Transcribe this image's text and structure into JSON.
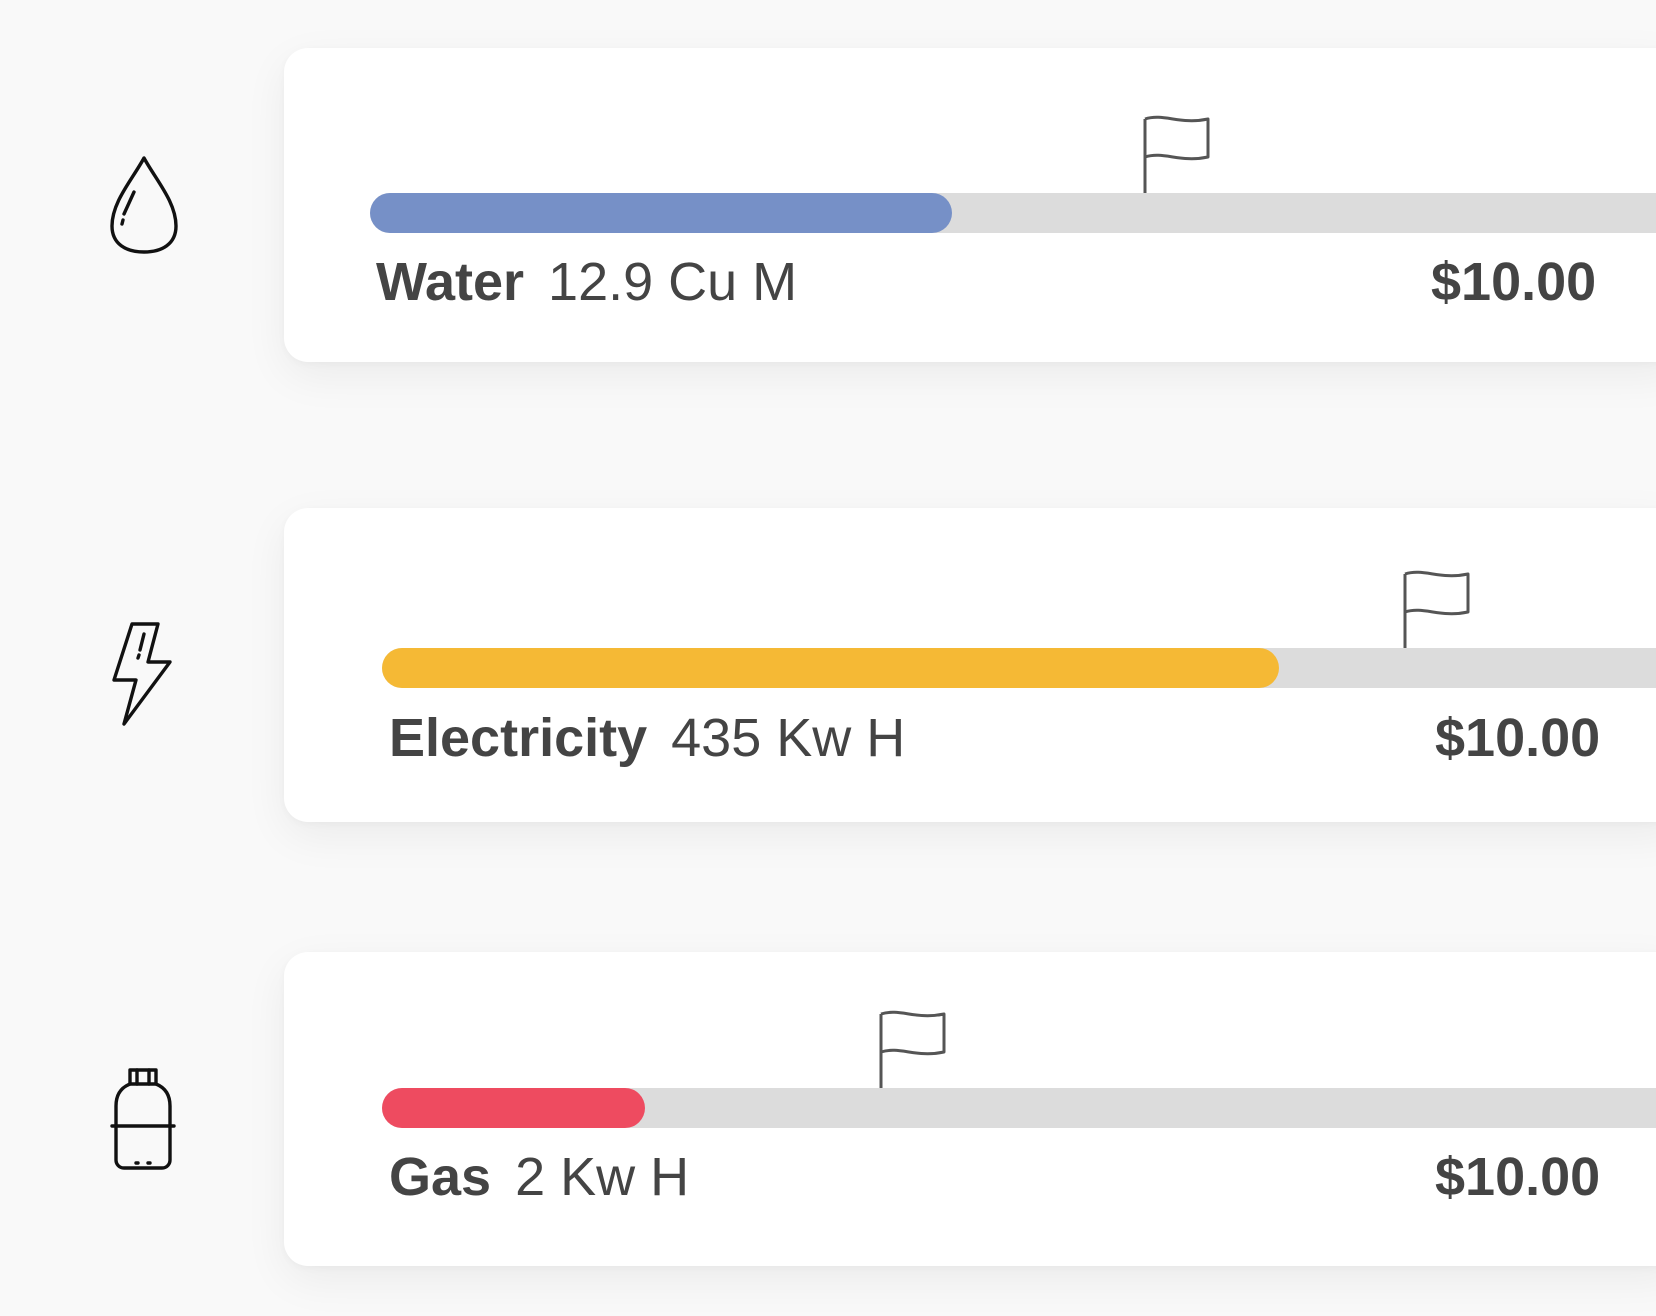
{
  "colors": {
    "background": "#f9f9f9",
    "card": "#ffffff",
    "track": "#dcdcdc",
    "text": "#444444"
  },
  "utilities": [
    {
      "name": "Water",
      "usage": "12.9 Cu M",
      "cost": "$10.00",
      "icon": "water-drop-icon",
      "fill_color": "#7690c7",
      "fill_fraction": 0.5,
      "goal_fraction": 0.6
    },
    {
      "name": "Electricity",
      "usage": "435 Kw H",
      "cost": "$10.00",
      "icon": "lightning-bolt-icon",
      "fill_color": "#f5b935",
      "fill_fraction": 0.75,
      "goal_fraction": 0.8
    },
    {
      "name": "Gas",
      "usage": "2 Kw H",
      "cost": "$10.00",
      "icon": "gas-cylinder-icon",
      "fill_color": "#ee4b60",
      "fill_fraction": 0.2,
      "goal_fraction": 0.4
    }
  ]
}
